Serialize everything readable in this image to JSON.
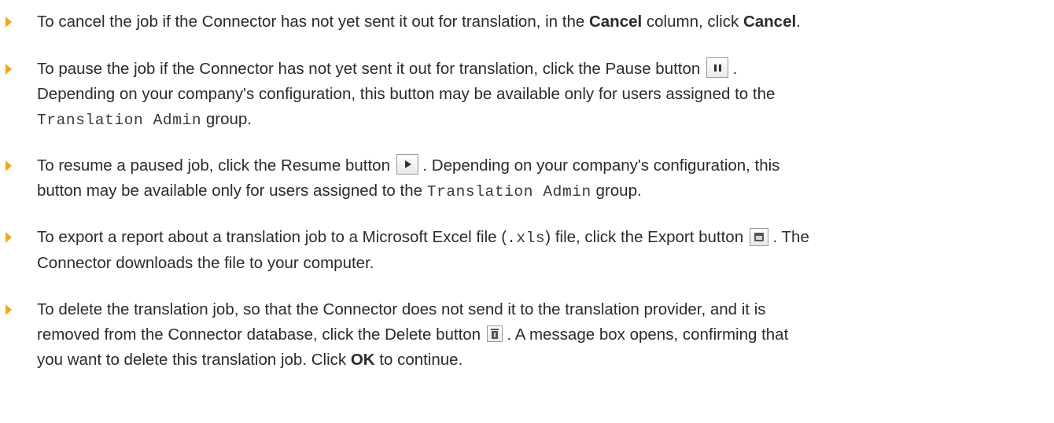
{
  "items": [
    {
      "t1": "To cancel the job if the Connector has not yet sent it out for translation, in the ",
      "b1": "Cancel",
      "t2": " column, click ",
      "b2": "Cancel",
      "t3": "."
    },
    {
      "t1": "To pause the job if the Connector has not yet sent it out for translation, click the Pause button ",
      "t2": " .",
      "line2": "Depending on your company's configuration, this button may be available only for users assigned to the",
      "code": "Translation Admin",
      "t3": " group."
    },
    {
      "t1": "To resume a paused job, click the Resume button ",
      "t2": " . Depending on your company's configuration, this",
      "line2": "button may be available only for users assigned to the ",
      "code": "Translation Admin",
      "t3": " group."
    },
    {
      "t1": "To export a report about a translation job to a Microsoft Excel file (",
      "code": ".xls",
      "t2": ") file, click the Export button ",
      "t3": " . The",
      "line2": "Connector downloads the file to your computer."
    },
    {
      "t1": "To delete the translation job, so that the Connector does not send it to the translation provider, and it is",
      "line2": "removed from the Connector database, click the Delete button ",
      "t2": " . A message box opens, confirming that",
      "line3a": "you want to delete this translation job. Click ",
      "b1": "OK",
      "line3b": " to continue."
    }
  ],
  "icons": {
    "bullet": "orange-triangle-bullet",
    "pause": "pause-icon",
    "resume": "play-icon",
    "export": "export-icon",
    "delete": "trash-icon"
  },
  "colors": {
    "bullet": "#f2a81d",
    "text": "#2b2b2b"
  }
}
